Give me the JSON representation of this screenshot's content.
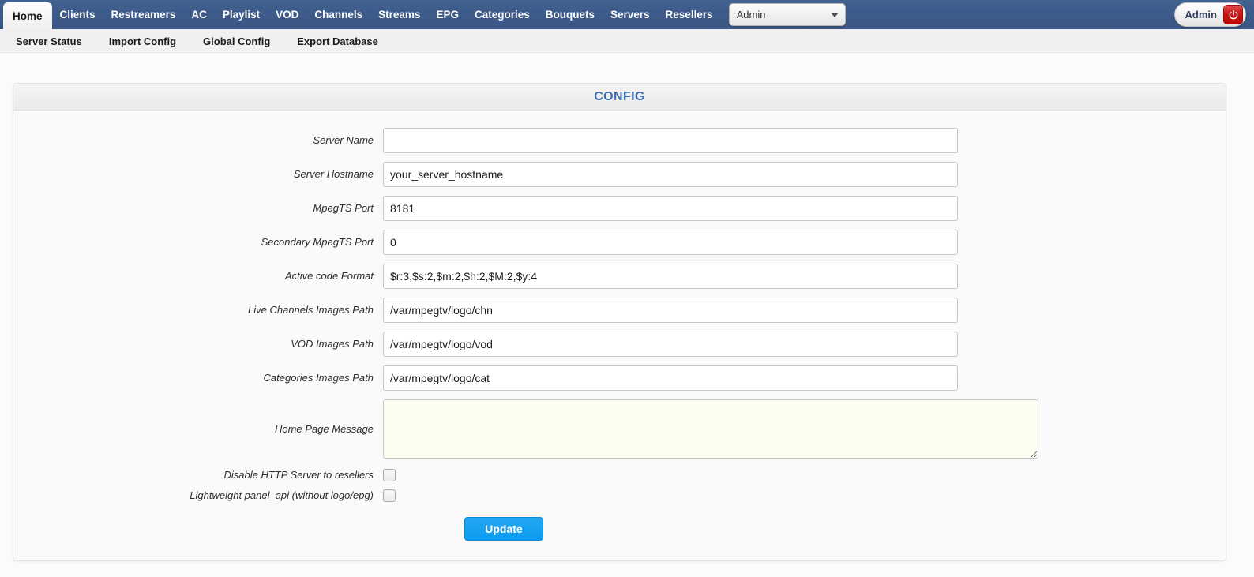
{
  "topnav": {
    "items": [
      {
        "label": "Home",
        "active": true
      },
      {
        "label": "Clients",
        "active": false
      },
      {
        "label": "Restreamers",
        "active": false
      },
      {
        "label": "AC",
        "active": false
      },
      {
        "label": "Playlist",
        "active": false
      },
      {
        "label": "VOD",
        "active": false
      },
      {
        "label": "Channels",
        "active": false
      },
      {
        "label": "Streams",
        "active": false
      },
      {
        "label": "EPG",
        "active": false
      },
      {
        "label": "Categories",
        "active": false
      },
      {
        "label": "Bouquets",
        "active": false
      },
      {
        "label": "Servers",
        "active": false
      },
      {
        "label": "Resellers",
        "active": false
      }
    ],
    "role_select": {
      "value": "Admin",
      "options": [
        "Admin"
      ]
    },
    "user": {
      "name": "Admin",
      "logout_icon": "power-icon"
    }
  },
  "subnav": {
    "items": [
      {
        "label": "Server Status"
      },
      {
        "label": "Import Config"
      },
      {
        "label": "Global Config"
      },
      {
        "label": "Export Database"
      }
    ]
  },
  "panel": {
    "title": "CONFIG"
  },
  "form": {
    "fields": [
      {
        "label": "Server Name",
        "value": "",
        "placeholder": ""
      },
      {
        "label": "Server Hostname",
        "value": "your_server_hostname",
        "placeholder": ""
      },
      {
        "label": "MpegTS Port",
        "value": "8181",
        "placeholder": ""
      },
      {
        "label": "Secondary MpegTS Port",
        "value": "0",
        "placeholder": ""
      },
      {
        "label": "Active code Format",
        "value": "$r:3,$s:2,$m:2,$h:2,$M:2,$y:4",
        "placeholder": ""
      },
      {
        "label": "Live Channels Images Path",
        "value": "/var/mpegtv/logo/chn",
        "placeholder": ""
      },
      {
        "label": "VOD Images Path",
        "value": "/var/mpegtv/logo/vod",
        "placeholder": ""
      },
      {
        "label": "Categories Images Path",
        "value": "/var/mpegtv/logo/cat",
        "placeholder": ""
      }
    ],
    "textarea": {
      "label": "Home Page Message",
      "value": "",
      "placeholder": ""
    },
    "checkboxes": [
      {
        "label": "Disable HTTP Server to resellers",
        "checked": false
      },
      {
        "label": "Lightweight panel_api (without logo/epg)",
        "checked": false
      }
    ],
    "submit_label": "Update"
  },
  "colors": {
    "navbar_blue": "#3c5a8c",
    "panel_title_blue": "#3c6eb4",
    "update_button_blue": "#0d9bef",
    "power_red": "#cc1111",
    "textarea_bg": "#fbfff0"
  }
}
